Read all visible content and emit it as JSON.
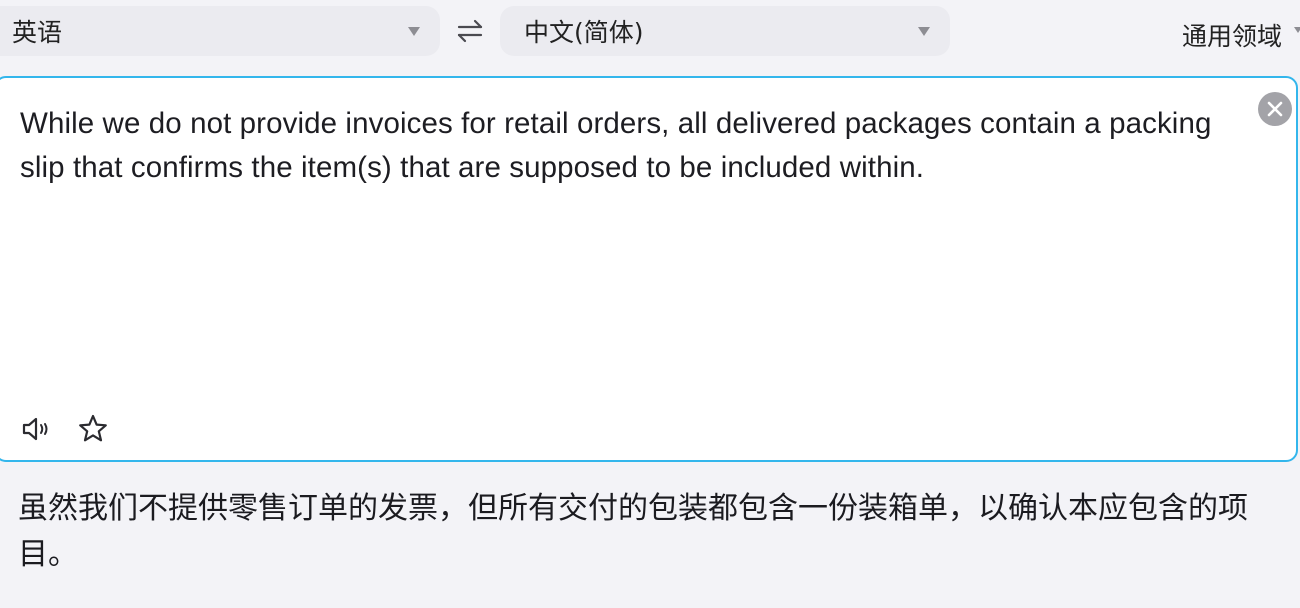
{
  "topbar": {
    "source_language": "英语",
    "target_language": "中文(简体)",
    "domain": "通用领域"
  },
  "source": {
    "text": "While we do not provide invoices for retail orders, all delivered packages contain a packing slip that confirms the item(s) that are supposed to be included within."
  },
  "result": {
    "text": "虽然我们不提供零售订单的发票，但所有交付的包装都包含一份装箱单，以确认本应包含的项目。"
  },
  "icons": {
    "swap": "swap-arrows-icon",
    "clear": "close-circle-icon",
    "speak": "speaker-icon",
    "star": "star-outline-icon"
  },
  "colors": {
    "accent_border": "#33b6ec",
    "background": "#f3f3f7",
    "selector_bg": "#ebebf0"
  }
}
